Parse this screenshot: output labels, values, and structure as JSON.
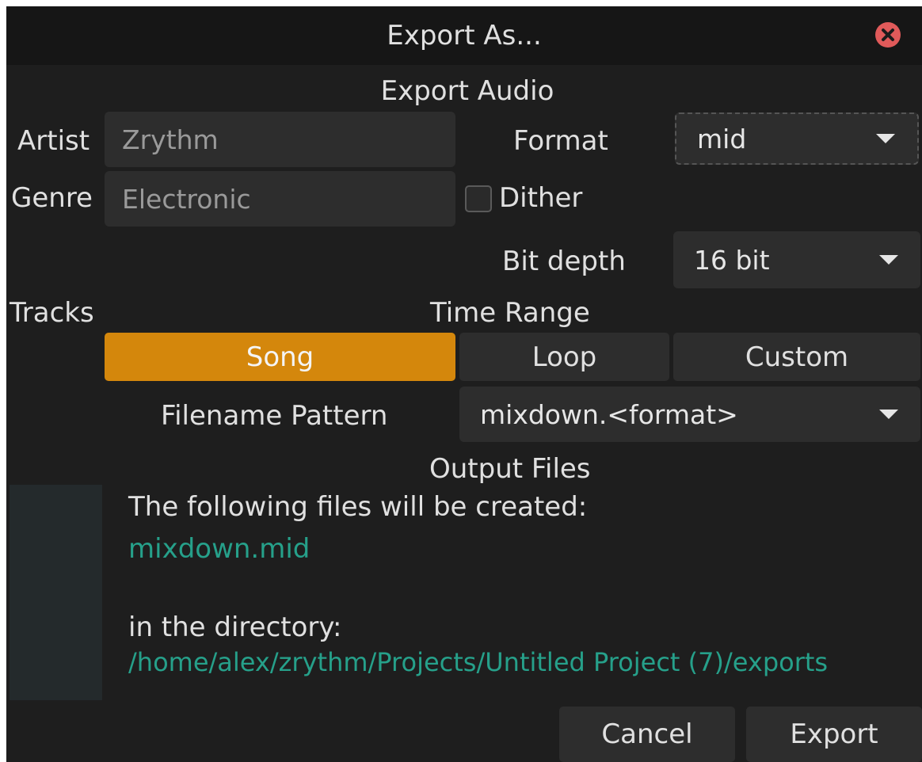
{
  "window": {
    "title": "Export As...",
    "close_icon": "close-icon",
    "close_color": "#e05a5a"
  },
  "section_title": "Export Audio",
  "artist": {
    "label": "Artist",
    "value": "Zrythm"
  },
  "genre": {
    "label": "Genre",
    "value": "Electronic"
  },
  "format": {
    "label": "Format",
    "value": "mid"
  },
  "dither": {
    "label": "Dither",
    "checked": false
  },
  "bit_depth": {
    "label": "Bit depth",
    "value": "16 bit"
  },
  "tracks": {
    "label": "Tracks"
  },
  "time_range": {
    "label": "Time Range",
    "options": [
      "Song",
      "Loop",
      "Custom"
    ],
    "selected": "Song",
    "selected_color": "#d4870c"
  },
  "filename_pattern": {
    "label": "Filename Pattern",
    "value": "mixdown.<format>"
  },
  "output": {
    "label": "Output Files",
    "intro": "The following files will be created:",
    "file": "mixdown.mid",
    "dir_intro": "in the directory:",
    "dir": "/home/alex/zrythm/Projects/Untitled Project (7)/exports",
    "link_color": "#26a08a"
  },
  "buttons": {
    "cancel": "Cancel",
    "export": "Export"
  }
}
